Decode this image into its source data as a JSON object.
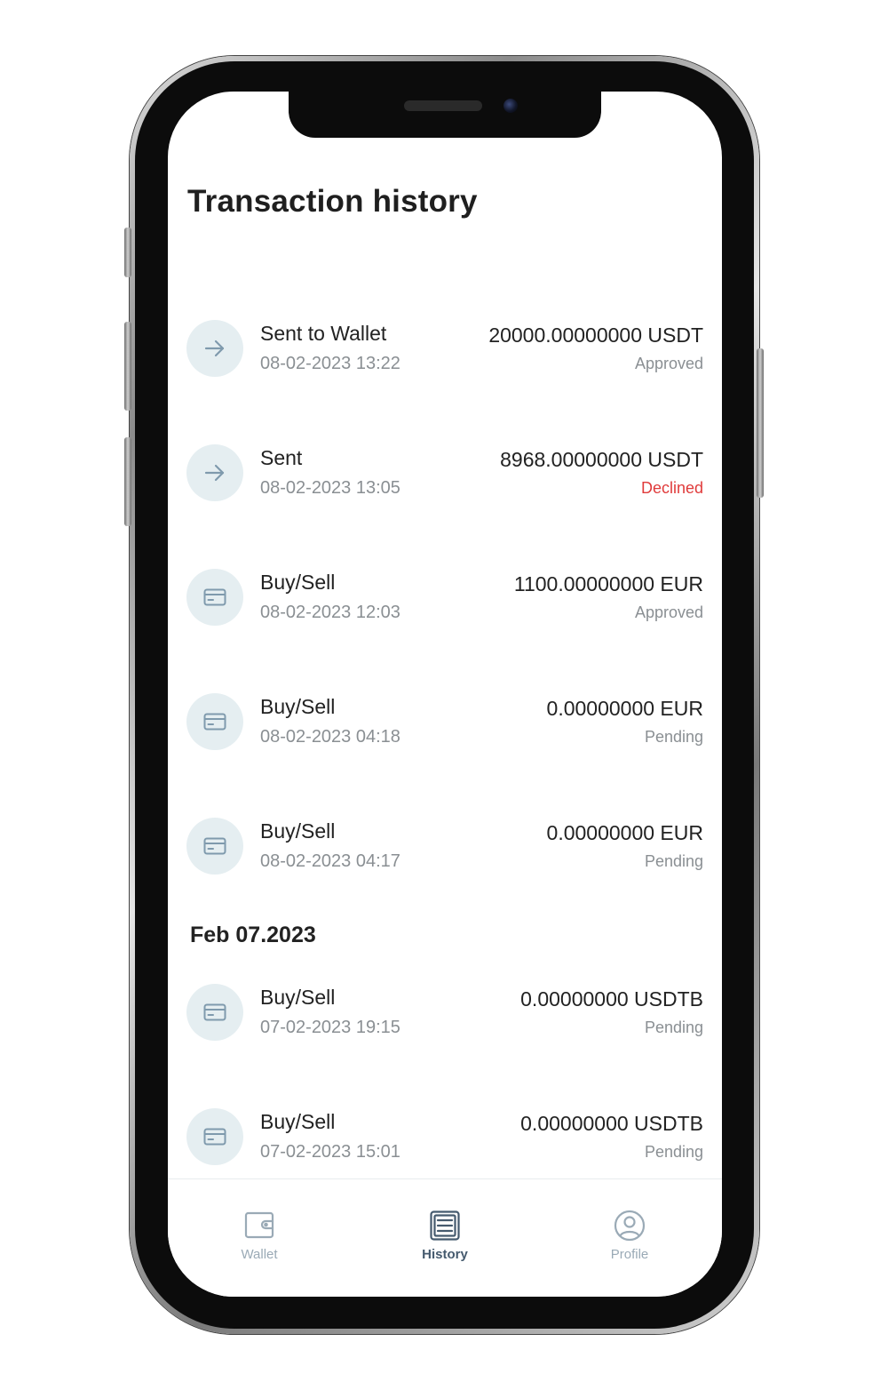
{
  "page": {
    "title": "Transaction history"
  },
  "transactions_recent": [
    {
      "icon": "arrow-right-icon",
      "title": "Sent to Wallet",
      "date": "08-02-2023 13:22",
      "amount": "20000.00000000 USDT",
      "status": "Approved"
    },
    {
      "icon": "arrow-right-icon",
      "title": "Sent",
      "date": "08-02-2023 13:05",
      "amount": "8968.00000000 USDT",
      "status": "Declined"
    },
    {
      "icon": "card-icon",
      "title": "Buy/Sell",
      "date": "08-02-2023 12:03",
      "amount": "1100.00000000 EUR",
      "status": "Approved"
    },
    {
      "icon": "card-icon",
      "title": "Buy/Sell",
      "date": "08-02-2023 04:18",
      "amount": "0.00000000 EUR",
      "status": "Pending"
    },
    {
      "icon": "card-icon",
      "title": "Buy/Sell",
      "date": "08-02-2023 04:17",
      "amount": "0.00000000 EUR",
      "status": "Pending"
    }
  ],
  "group_header": "Feb 07.2023",
  "transactions_feb07": [
    {
      "icon": "card-icon",
      "title": "Buy/Sell",
      "date": "07-02-2023 19:15",
      "amount": "0.00000000 USDTB",
      "status": "Pending"
    },
    {
      "icon": "card-icon",
      "title": "Buy/Sell",
      "date": "07-02-2023 15:01",
      "amount": "0.00000000 USDTB",
      "status": "Pending"
    }
  ],
  "nav": {
    "items": [
      {
        "label": "Wallet",
        "icon": "wallet-icon",
        "active": false
      },
      {
        "label": "History",
        "icon": "history-list-icon",
        "active": true
      },
      {
        "label": "Profile",
        "icon": "profile-icon",
        "active": false
      }
    ]
  },
  "colors": {
    "icon_bg": "#e5eef1",
    "icon_stroke": "#7f9aad",
    "text_primary": "#222222",
    "text_secondary": "#8a8f93",
    "status_declined": "#e03b3b",
    "nav_active": "#455a6e",
    "nav_inactive": "#9aaab6"
  }
}
